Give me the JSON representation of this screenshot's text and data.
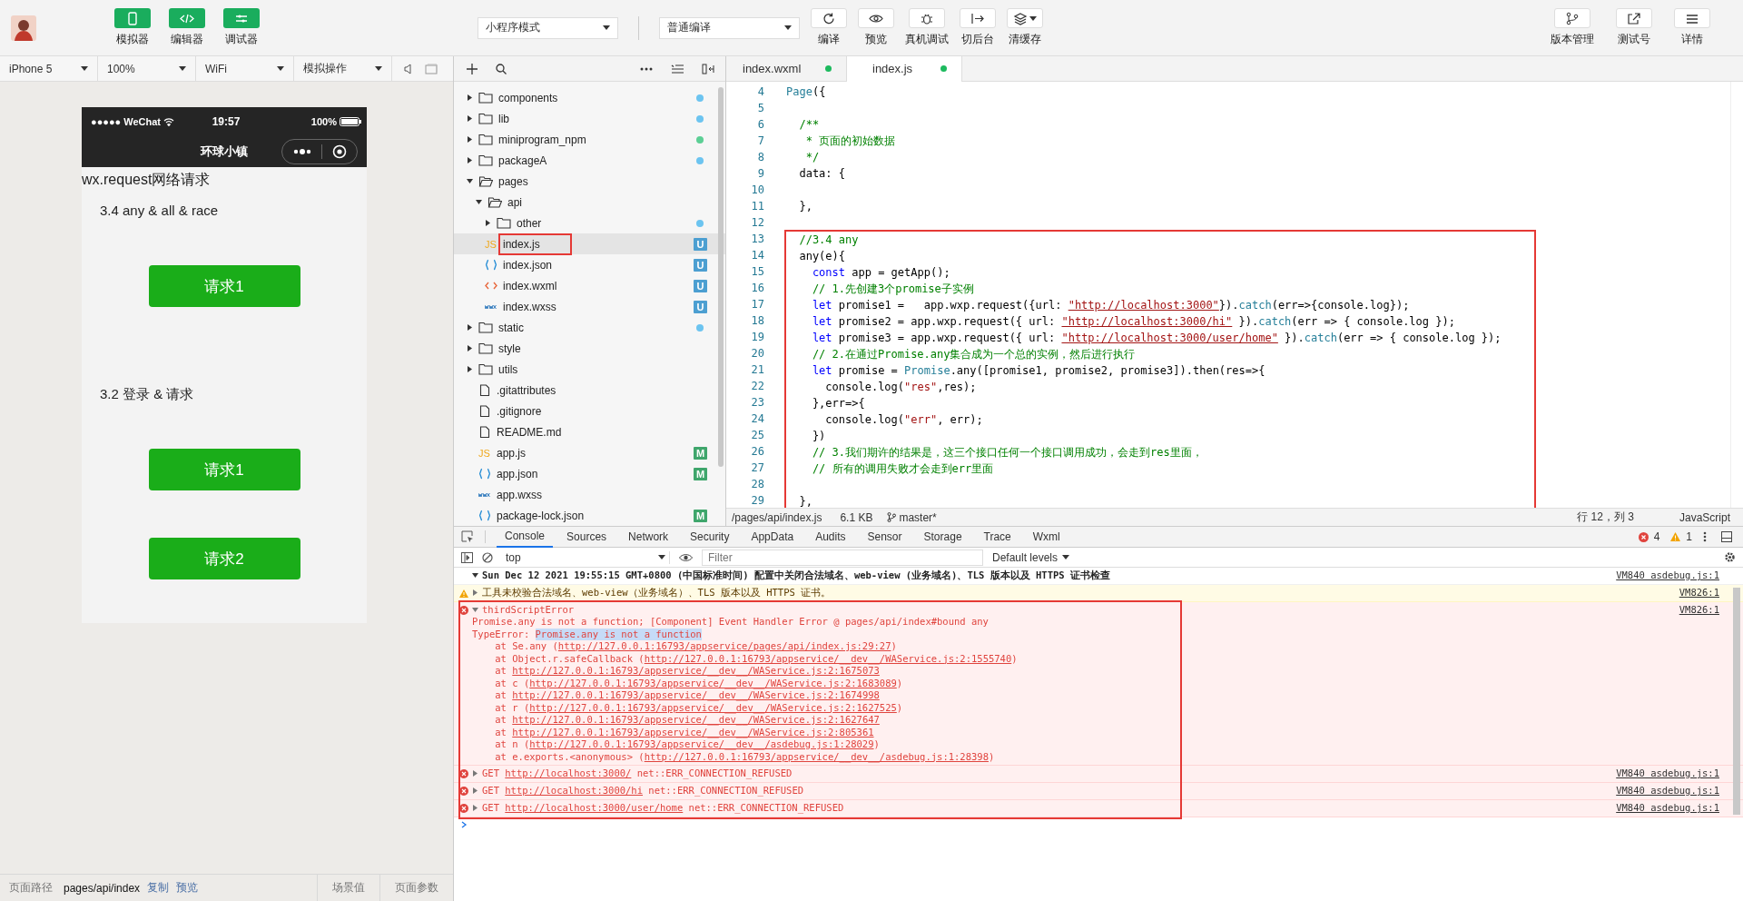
{
  "toolbar": {
    "left": [
      {
        "label": "模拟器",
        "on": true
      },
      {
        "label": "编辑器",
        "on": true
      },
      {
        "label": "调试器",
        "on": true
      }
    ],
    "mode_select": "小程序模式",
    "compile_select": "普通编译",
    "actions": [
      {
        "label": "编译"
      },
      {
        "label": "预览"
      },
      {
        "label": "真机调试"
      },
      {
        "label": "切后台"
      },
      {
        "label": "清缓存"
      }
    ],
    "right": [
      {
        "label": "版本管理"
      },
      {
        "label": "测试号"
      },
      {
        "label": "详情"
      }
    ]
  },
  "simulator": {
    "selects": [
      "iPhone 5",
      "100%",
      "WiFi",
      "模拟操作"
    ],
    "phone": {
      "signal": "●●●●● WeChat",
      "time": "19:57",
      "battery": "100%",
      "title": "环球小镇",
      "items": [
        {
          "kind": "heading",
          "text": "wx.request网络请求"
        },
        {
          "kind": "section",
          "text": "3.4 any & all & race"
        },
        {
          "kind": "button",
          "text": "请求1"
        },
        {
          "kind": "section",
          "text": "3.2 登录 & 请求"
        },
        {
          "kind": "button",
          "text": "请求1"
        },
        {
          "kind": "button",
          "text": "请求2"
        }
      ]
    },
    "footer": {
      "label": "页面路径",
      "path": "pages/api/index",
      "links": [
        "复制",
        "预览"
      ],
      "tabs": [
        "场景值",
        "页面参数"
      ]
    }
  },
  "file_tree": [
    {
      "name": "components",
      "kind": "folder",
      "expanded": false,
      "color": "#6cc4f0"
    },
    {
      "name": "lib",
      "kind": "folder",
      "expanded": false,
      "color": "#6cc4f0"
    },
    {
      "name": "miniprogram_npm",
      "kind": "folder",
      "expanded": false,
      "color": "#5ccf95"
    },
    {
      "name": "packageA",
      "kind": "folder",
      "expanded": false,
      "color": "#6cc4f0"
    },
    {
      "name": "pages",
      "kind": "folder",
      "expanded": true,
      "children": [
        {
          "name": "api",
          "kind": "folder",
          "expanded": true,
          "children": [
            {
              "name": "other",
              "kind": "folder",
              "expanded": false,
              "color": "#6cc4f0"
            },
            {
              "name": "index.js",
              "kind": "js",
              "icon_text": "JS",
              "selected": true,
              "highlighted": true,
              "badge": "U",
              "color": "#4c9fd1"
            },
            {
              "name": "index.json",
              "kind": "json",
              "selected": false,
              "badge": "U",
              "color": "#4c9fd1"
            },
            {
              "name": "index.wxml",
              "kind": "wxml",
              "selected": false,
              "badge": "U",
              "color": "#4c9fd1"
            },
            {
              "name": "index.wxss",
              "kind": "wxss",
              "selected": false,
              "badge": "U",
              "color": "#4c9fd1"
            }
          ]
        }
      ]
    },
    {
      "name": "static",
      "kind": "folder",
      "expanded": false,
      "color": "#6cc4f0"
    },
    {
      "name": "style",
      "kind": "folder",
      "expanded": false
    },
    {
      "name": "utils",
      "kind": "folder",
      "expanded": false
    },
    {
      "name": ".gitattributes",
      "kind": "file",
      "selected": false
    },
    {
      "name": ".gitignore",
      "kind": "file",
      "selected": false
    },
    {
      "name": "README.md",
      "kind": "file",
      "selected": false
    },
    {
      "name": "app.js",
      "kind": "js",
      "icon_text": "JS",
      "selected": false,
      "badge": "M",
      "color": "#3fa66c"
    },
    {
      "name": "app.json",
      "kind": "json",
      "selected": false,
      "badge": "M",
      "color": "#3fa66c"
    },
    {
      "name": "app.wxss",
      "kind": "wxss",
      "selected": false
    },
    {
      "name": "package-lock.json",
      "kind": "json",
      "selected": false,
      "badge": "M",
      "color": "#3fa66c"
    }
  ],
  "editor": {
    "tabs": [
      {
        "label": "index.wxml",
        "selected": false,
        "color": "#1dba5e"
      },
      {
        "label": "index.js",
        "selected": true,
        "color": "#1dba5e"
      }
    ],
    "blocks": [
      {
        "highlighted": false,
        "lines": [
          {
            "number": "4",
            "tokens": [
              {
                "text": "Page",
                "kind": "type"
              },
              {
                "text": "({",
                "kind": "plain"
              }
            ]
          },
          {
            "number": "5"
          },
          {
            "number": "6",
            "tokens": [
              {
                "text": "  /**",
                "kind": "comment"
              }
            ]
          },
          {
            "number": "7",
            "tokens": [
              {
                "text": "   * 页面的初始数据",
                "kind": "comment"
              }
            ]
          },
          {
            "number": "8",
            "tokens": [
              {
                "text": "   */",
                "kind": "comment"
              }
            ]
          },
          {
            "number": "9",
            "tokens": [
              {
                "text": "  data: {",
                "kind": "plain"
              }
            ]
          },
          {
            "number": "10"
          },
          {
            "number": "11",
            "tokens": [
              {
                "text": "  },",
                "kind": "plain"
              }
            ]
          },
          {
            "number": "12"
          }
        ]
      },
      {
        "highlighted": true,
        "lines": [
          {
            "number": "13",
            "tokens": [
              {
                "text": "  //3.4 any",
                "kind": "comment"
              }
            ]
          },
          {
            "number": "14",
            "tokens": [
              {
                "text": "  any(e){",
                "kind": "plain"
              }
            ]
          },
          {
            "number": "15",
            "tokens": [
              {
                "text": "    const",
                "kind": "keyword"
              },
              {
                "text": " app = getApp();",
                "kind": "plain"
              }
            ]
          },
          {
            "number": "16",
            "tokens": [
              {
                "text": "    // 1.先创建3个promise子实例",
                "kind": "comment"
              }
            ]
          },
          {
            "number": "17",
            "tokens": [
              {
                "text": "    let",
                "kind": "keyword"
              },
              {
                "text": " promise1 =   app.wxp.request({url: ",
                "kind": "plain"
              },
              {
                "text": "\"http://localhost:3000\"",
                "kind": "url"
              },
              {
                "text": "}).",
                "kind": "plain"
              },
              {
                "text": "catch",
                "kind": "type"
              },
              {
                "text": "(err=>{console.log});",
                "kind": "plain"
              }
            ]
          },
          {
            "number": "18",
            "tokens": [
              {
                "text": "    let",
                "kind": "keyword"
              },
              {
                "text": " promise2 = app.wxp.request({ url: ",
                "kind": "plain"
              },
              {
                "text": "\"http://localhost:3000/hi\"",
                "kind": "url"
              },
              {
                "text": " }).",
                "kind": "plain"
              },
              {
                "text": "catch",
                "kind": "type"
              },
              {
                "text": "(err => { console.log });",
                "kind": "plain"
              }
            ]
          },
          {
            "number": "19",
            "tokens": [
              {
                "text": "    let",
                "kind": "keyword"
              },
              {
                "text": " promise3 = app.wxp.request({ url: ",
                "kind": "plain"
              },
              {
                "text": "\"http://localhost:3000/user/home\"",
                "kind": "url"
              },
              {
                "text": " }).",
                "kind": "plain"
              },
              {
                "text": "catch",
                "kind": "type"
              },
              {
                "text": "(err => { console.log });",
                "kind": "plain"
              }
            ]
          },
          {
            "number": "20",
            "tokens": [
              {
                "text": "    // 2.在通过Promise.any集合成为一个总的实例，然后进行执行",
                "kind": "comment"
              }
            ]
          },
          {
            "number": "21",
            "tokens": [
              {
                "text": "    let",
                "kind": "keyword"
              },
              {
                "text": " promise = ",
                "kind": "plain"
              },
              {
                "text": "Promise",
                "kind": "type"
              },
              {
                "text": ".any([promise1, promise2, promise3]).then(res=>{",
                "kind": "plain"
              }
            ]
          },
          {
            "number": "22",
            "tokens": [
              {
                "text": "      console.log(",
                "kind": "plain"
              },
              {
                "text": "\"res\"",
                "kind": "string"
              },
              {
                "text": ",res);",
                "kind": "plain"
              }
            ]
          },
          {
            "number": "23",
            "tokens": [
              {
                "text": "    },err=>{",
                "kind": "plain"
              }
            ]
          },
          {
            "number": "24",
            "tokens": [
              {
                "text": "      console.log(",
                "kind": "plain"
              },
              {
                "text": "\"err\"",
                "kind": "string"
              },
              {
                "text": ", err);",
                "kind": "plain"
              }
            ]
          },
          {
            "number": "25",
            "tokens": [
              {
                "text": "    })",
                "kind": "plain"
              }
            ]
          },
          {
            "number": "26",
            "tokens": [
              {
                "text": "    // 3.我们期许的结果是，这三个接口任何一个接口调用成功，会走到res里面，",
                "kind": "comment"
              }
            ]
          },
          {
            "number": "27",
            "tokens": [
              {
                "text": "    // 所有的调用失败才会走到err里面",
                "kind": "comment"
              }
            ]
          },
          {
            "number": "28"
          },
          {
            "number": "29",
            "tokens": [
              {
                "text": "  },",
                "kind": "plain"
              }
            ]
          }
        ]
      }
    ],
    "status": {
      "path": "/pages/api/index.js",
      "size": "6.1 KB",
      "branch": "master*",
      "cursor": "行 12，列 3",
      "language": "JavaScript"
    }
  },
  "console": {
    "tabs": [
      {
        "label": "Console",
        "selected": true
      },
      {
        "label": "Sources",
        "selected": false
      },
      {
        "label": "Network",
        "selected": false
      },
      {
        "label": "Security",
        "selected": false
      },
      {
        "label": "AppData",
        "selected": false
      },
      {
        "label": "Audits",
        "selected": false
      },
      {
        "label": "Sensor",
        "selected": false
      },
      {
        "label": "Storage",
        "selected": false
      },
      {
        "label": "Trace",
        "selected": false
      },
      {
        "label": "Wxml",
        "selected": false
      }
    ],
    "error_count": "4",
    "warning_count": "1",
    "context": "top",
    "filter_placeholder": "Filter",
    "levels": "Default levels",
    "groups": [
      {
        "highlighted": false,
        "messages": [
          {
            "kind": "info",
            "expanded": true,
            "lines": [
              [
                {
                  "text": "Sun Dec 12 2021 19:55:15 GMT+0800 (中国标准时间) 配置中关闭合法域名、web-view (业务域名)、TLS 版本以及 HTTPS 证书检查"
                }
              ]
            ],
            "source": "VM840 asdebug.js:1"
          },
          {
            "kind": "warning",
            "expanded": false,
            "lines": [
              [
                {
                  "text": "工具未校验合法域名、web-view（业务域名）、TLS 版本以及 HTTPS 证书。"
                }
              ]
            ],
            "source": "VM826:1"
          }
        ]
      },
      {
        "highlighted": true,
        "messages": [
          {
            "kind": "error",
            "expanded": true,
            "lines": [
              [
                {
                  "text": "thirdScriptError"
                }
              ],
              [
                {
                  "text": "Promise.any is not a function; [Component] Event Handler Error @ pages/api/index#bound any"
                }
              ],
              [
                {
                  "text": "TypeError: "
                },
                {
                  "text": "Promise.any is not a function",
                  "kind": "selected"
                }
              ],
              [
                {
                  "text": "    at Se.any ("
                },
                {
                  "text": "http://127.0.0.1:16793/appservice/pages/api/index.js:29:27",
                  "kind": "link"
                },
                {
                  "text": ")"
                }
              ],
              [
                {
                  "text": "    at Object.r.safeCallback ("
                },
                {
                  "text": "http://127.0.0.1:16793/appservice/__dev__/WAService.js:2:1555740",
                  "kind": "link"
                },
                {
                  "text": ")"
                }
              ],
              [
                {
                  "text": "    at "
                },
                {
                  "text": "http://127.0.0.1:16793/appservice/__dev__/WAService.js:2:1675073",
                  "kind": "link"
                }
              ],
              [
                {
                  "text": "    at c ("
                },
                {
                  "text": "http://127.0.0.1:16793/appservice/__dev__/WAService.js:2:1683089",
                  "kind": "link"
                },
                {
                  "text": ")"
                }
              ],
              [
                {
                  "text": "    at "
                },
                {
                  "text": "http://127.0.0.1:16793/appservice/__dev__/WAService.js:2:1674998",
                  "kind": "link"
                }
              ],
              [
                {
                  "text": "    at r ("
                },
                {
                  "text": "http://127.0.0.1:16793/appservice/__dev__/WAService.js:2:1627525",
                  "kind": "link"
                },
                {
                  "text": ")"
                }
              ],
              [
                {
                  "text": "    at "
                },
                {
                  "text": "http://127.0.0.1:16793/appservice/__dev__/WAService.js:2:1627647",
                  "kind": "link"
                }
              ],
              [
                {
                  "text": "    at "
                },
                {
                  "text": "http://127.0.0.1:16793/appservice/__dev__/WAService.js:2:805361",
                  "kind": "link"
                }
              ],
              [
                {
                  "text": "    at n ("
                },
                {
                  "text": "http://127.0.0.1:16793/appservice/__dev__/asdebug.js:1:28029",
                  "kind": "link"
                },
                {
                  "text": ")"
                }
              ],
              [
                {
                  "text": "    at e.exports.<anonymous> ("
                },
                {
                  "text": "http://127.0.0.1:16793/appservice/__dev__/asdebug.js:1:28398",
                  "kind": "link"
                },
                {
                  "text": ")"
                }
              ]
            ],
            "source": "VM826:1"
          },
          {
            "kind": "error",
            "expanded": false,
            "lines": [
              [
                {
                  "text": "GET "
                },
                {
                  "text": "http://localhost:3000/",
                  "kind": "link"
                },
                {
                  "text": " net::ERR_CONNECTION_REFUSED"
                }
              ]
            ],
            "source": "VM840 asdebug.js:1"
          },
          {
            "kind": "error",
            "expanded": false,
            "lines": [
              [
                {
                  "text": "GET "
                },
                {
                  "text": "http://localhost:3000/hi",
                  "kind": "link"
                },
                {
                  "text": " net::ERR_CONNECTION_REFUSED"
                }
              ]
            ],
            "source": "VM840 asdebug.js:1"
          },
          {
            "kind": "error",
            "expanded": false,
            "lines": [
              [
                {
                  "text": "GET "
                },
                {
                  "text": "http://localhost:3000/user/home",
                  "kind": "link"
                },
                {
                  "text": " net::ERR_CONNECTION_REFUSED"
                }
              ]
            ],
            "source": "VM840 asdebug.js:1"
          }
        ]
      }
    ]
  }
}
